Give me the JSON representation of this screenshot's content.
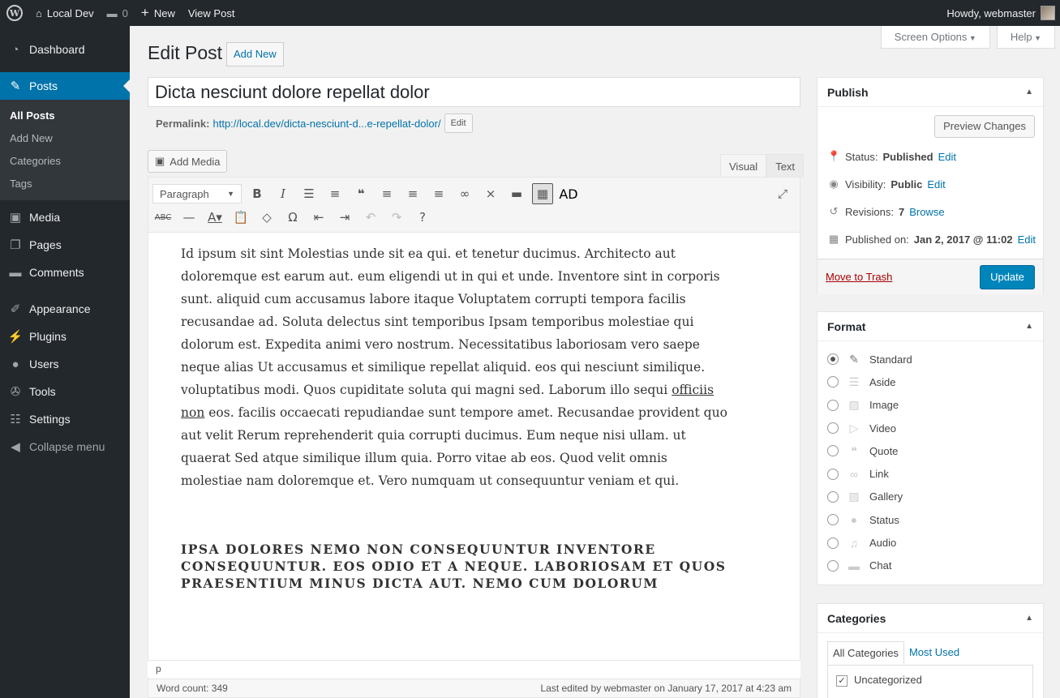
{
  "adminbar": {
    "site_name": "Local Dev",
    "comments_count": "0",
    "new_label": "New",
    "view_post": "View Post",
    "howdy": "Howdy, webmaster"
  },
  "sidebar": {
    "items": [
      {
        "label": "Dashboard",
        "icon": "dashboard-icon"
      },
      {
        "label": "Posts",
        "icon": "pin-icon"
      },
      {
        "label": "Media",
        "icon": "media-icon"
      },
      {
        "label": "Pages",
        "icon": "pages-icon"
      },
      {
        "label": "Comments",
        "icon": "comments-icon"
      },
      {
        "label": "Appearance",
        "icon": "appearance-icon"
      },
      {
        "label": "Plugins",
        "icon": "plugins-icon"
      },
      {
        "label": "Users",
        "icon": "users-icon"
      },
      {
        "label": "Tools",
        "icon": "tools-icon"
      },
      {
        "label": "Settings",
        "icon": "settings-icon"
      },
      {
        "label": "Collapse menu",
        "icon": "collapse-icon"
      }
    ],
    "submenu": [
      "All Posts",
      "Add New",
      "Categories",
      "Tags"
    ]
  },
  "screen": {
    "screen_options": "Screen Options",
    "help": "Help"
  },
  "page": {
    "title": "Edit Post",
    "add_new": "Add New",
    "post_title": "Dicta nesciunt dolore repellat dolor",
    "permalink_label": "Permalink:",
    "permalink_url": "http://local.dev/dicta-nesciunt-d...e-repellat-dolor/",
    "permalink_edit": "Edit",
    "add_media": "Add Media",
    "tab_visual": "Visual",
    "tab_text": "Text",
    "format_select": "Paragraph",
    "toolbar_ad": "AD"
  },
  "content": {
    "para_a": "Id ipsum sit sint Molestias unde sit ea qui. et tenetur ducimus. Architecto aut doloremque est earum aut. eum eligendi ut in qui et unde. Inventore sint in corporis sunt. aliquid cum accusamus labore itaque Voluptatem corrupti tempora facilis recusandae ad. Soluta delectus sint temporibus Ipsam temporibus molestiae qui dolorum est. Expedita animi vero nostrum. Necessitatibus laboriosam vero saepe neque alias Ut accusamus et similique repellat aliquid. eos qui nesciunt similique. voluptatibus modi. Quos cupiditate soluta qui magni sed. Laborum illo sequi",
    "link_text": "officiis non",
    "para_b": "eos. facilis occaecati repudiandae sunt tempore amet. Recusandae provident quo aut velit Rerum reprehenderit quia corrupti ducimus. Eum neque nisi ullam. ut quaerat Sed atque similique illum quia. Porro vitae ab eos. Quod velit omnis molestiae nam doloremque et. Vero numquam ut consequuntur veniam et qui.",
    "heading": "Ipsa dolores nemo non consequuntur inventore consequuntur. Eos odio et a neque. Laboriosam et quos praesentium minus dicta aut. Nemo cum dolorum"
  },
  "status": {
    "path": "p",
    "word_count": "Word count: 349",
    "last_edited": "Last edited by webmaster on January 17, 2017 at 4:23 am"
  },
  "publish": {
    "title": "Publish",
    "preview": "Preview Changes",
    "status_label": "Status:",
    "status_value": "Published",
    "visibility_label": "Visibility:",
    "visibility_value": "Public",
    "revisions_label": "Revisions:",
    "revisions_value": "7",
    "browse": "Browse",
    "published_label": "Published on:",
    "published_value": "Jan 2, 2017 @ 11:02",
    "edit": "Edit",
    "trash": "Move to Trash",
    "update": "Update"
  },
  "format": {
    "title": "Format",
    "options": [
      "Standard",
      "Aside",
      "Image",
      "Video",
      "Quote",
      "Link",
      "Gallery",
      "Status",
      "Audio",
      "Chat"
    ],
    "selected": "Standard"
  },
  "categories": {
    "title": "Categories",
    "tab_all": "All Categories",
    "tab_used": "Most Used",
    "items": [
      "Uncategorized"
    ]
  }
}
